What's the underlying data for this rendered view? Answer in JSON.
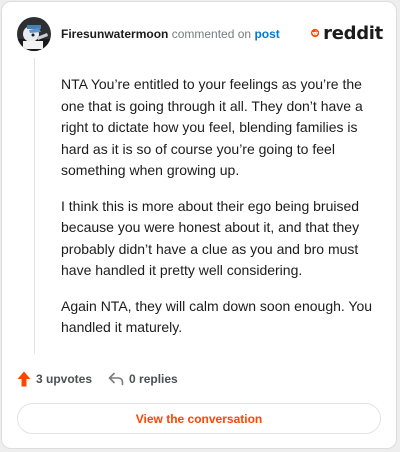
{
  "header": {
    "username": "Firesunwatermoon",
    "action_text": "commented on",
    "post_link": "post"
  },
  "brand": {
    "name": "reddit",
    "icon": "reddit-snoo-icon",
    "accent_color": "#ff4500"
  },
  "comment": {
    "paragraphs": [
      "NTA You’re entitled to your feelings as you’re the one that is going through it all. They don’t have a right to dictate how you feel, blending families is hard as it is so of course you’re going to feel something when growing up.",
      "I think this is more about their ego being bruised because you were honest about it, and that they probably didn’t have a clue as you and bro must have handled it pretty well considering.",
      "Again NTA, they will calm down soon enough. You handled it maturely."
    ]
  },
  "stats": {
    "upvotes_label": "3 upvotes",
    "replies_label": "0 replies",
    "upvote_icon": "upvote-arrow-icon",
    "reply_icon": "reply-arrow-icon"
  },
  "actions": {
    "view_conversation_label": "View the conversation"
  }
}
